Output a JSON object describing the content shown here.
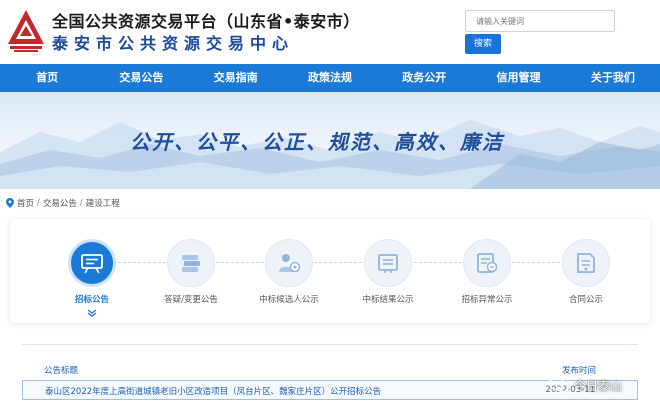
{
  "header": {
    "title": "全国公共资源交易平台（山东省•泰安市）",
    "subtitle": "泰安市公共资源交易中心",
    "search_placeholder": "请输入关键词",
    "search_button": "搜索",
    "brand_color": "#1b7ad8",
    "logo_color": "#c4282a"
  },
  "nav": {
    "items": [
      "首页",
      "交易公告",
      "交易指南",
      "政策法规",
      "政务公开",
      "信用管理",
      "关于我们"
    ]
  },
  "banner": {
    "slogan": "公开、公平、公正、规范、高效、廉洁"
  },
  "breadcrumb": {
    "icon": "location-pin-icon",
    "items": [
      "首页",
      "交易公告",
      "建设工程"
    ],
    "separator": "/"
  },
  "steps": {
    "active_index": 0,
    "items": [
      {
        "label": "招标公告",
        "icon": "bidding-announcement-icon"
      },
      {
        "label": "答疑/变更公告",
        "icon": "qa-change-icon"
      },
      {
        "label": "中标候选人公示",
        "icon": "candidate-icon"
      },
      {
        "label": "中标结果公示",
        "icon": "result-icon"
      },
      {
        "label": "招标异常公示",
        "icon": "anomaly-icon"
      },
      {
        "label": "合同公示",
        "icon": "contract-icon"
      }
    ]
  },
  "list": {
    "col_title": "公告标题",
    "col_time": "发布时间",
    "rows": [
      {
        "title": "泰山区2022年度上高街道城镇老旧小区改造项目（凤台片区、魏家庄片区）公开招标公告",
        "time": "2022-03-11"
      }
    ]
  },
  "watermark": {
    "text": "今日泰山",
    "icon": "wechat-icon"
  }
}
